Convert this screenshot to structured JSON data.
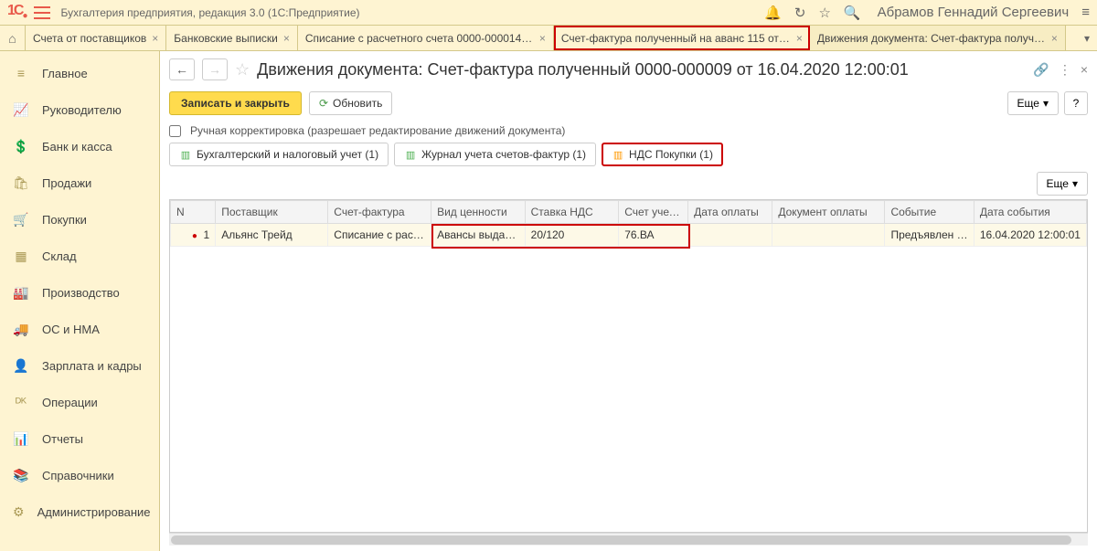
{
  "topbar": {
    "title": "Бухгалтерия предприятия, редакция 3.0  (1С:Предприятие)",
    "user": "Абрамов Геннадий Сергеевич"
  },
  "tabs": [
    {
      "label": "Счета от поставщиков"
    },
    {
      "label": "Банковские выписки"
    },
    {
      "label": "Списание с расчетного счета 0000-000014 от 16.0…"
    },
    {
      "label": "Счет-фактура полученный на аванс 115 от 16.04.2…",
      "highlight": true
    },
    {
      "label": "Движения документа: Счет-фактура полученный 0…",
      "active": true
    }
  ],
  "sidebar": {
    "items": [
      {
        "icon": "≡",
        "label": "Главное"
      },
      {
        "icon": "📈",
        "label": "Руководителю"
      },
      {
        "icon": "💲",
        "label": "Банк и касса"
      },
      {
        "icon": "🛍",
        "label": "Продажи"
      },
      {
        "icon": "🛒",
        "label": "Покупки"
      },
      {
        "icon": "▦",
        "label": "Склад"
      },
      {
        "icon": "🏭",
        "label": "Производство"
      },
      {
        "icon": "🚚",
        "label": "ОС и НМА"
      },
      {
        "icon": "👤",
        "label": "Зарплата и кадры"
      },
      {
        "icon": "ᴰᴷ",
        "label": "Операции"
      },
      {
        "icon": "📊",
        "label": "Отчеты"
      },
      {
        "icon": "📚",
        "label": "Справочники"
      },
      {
        "icon": "⚙",
        "label": "Администрирование"
      }
    ]
  },
  "header": {
    "title": "Движения документа: Счет-фактура полученный 0000-000009 от 16.04.2020 12:00:01"
  },
  "toolbar": {
    "save_close": "Записать и закрыть",
    "refresh": "Обновить",
    "more": "Еще"
  },
  "checkbox": {
    "label": "Ручная корректировка (разрешает редактирование движений документа)"
  },
  "subtabs": [
    {
      "label": "Бухгалтерский и налоговый учет (1)",
      "icon_color": "#4caf50"
    },
    {
      "label": "Журнал учета счетов-фактур (1)",
      "icon_color": "#4caf50"
    },
    {
      "label": "НДС Покупки (1)",
      "highlight": true,
      "icon_color": "#ff9800"
    }
  ],
  "table": {
    "more": "Еще",
    "columns": [
      "N",
      "Поставщик",
      "Счет-фактура",
      "Вид ценности",
      "Ставка НДС",
      "Счет учет…",
      "Дата оплаты",
      "Документ оплаты",
      "Событие",
      "Дата события"
    ],
    "rows": [
      {
        "n": "1",
        "supplier": "Альянс Трейд",
        "sf": "Списание с расче…",
        "kind": "Авансы выдан…",
        "rate": "20/120",
        "acct": "76.ВА",
        "paydate": "",
        "paydoc": "",
        "event": "Предъявлен Н…",
        "evdate": "16.04.2020 12:00:01"
      }
    ]
  }
}
